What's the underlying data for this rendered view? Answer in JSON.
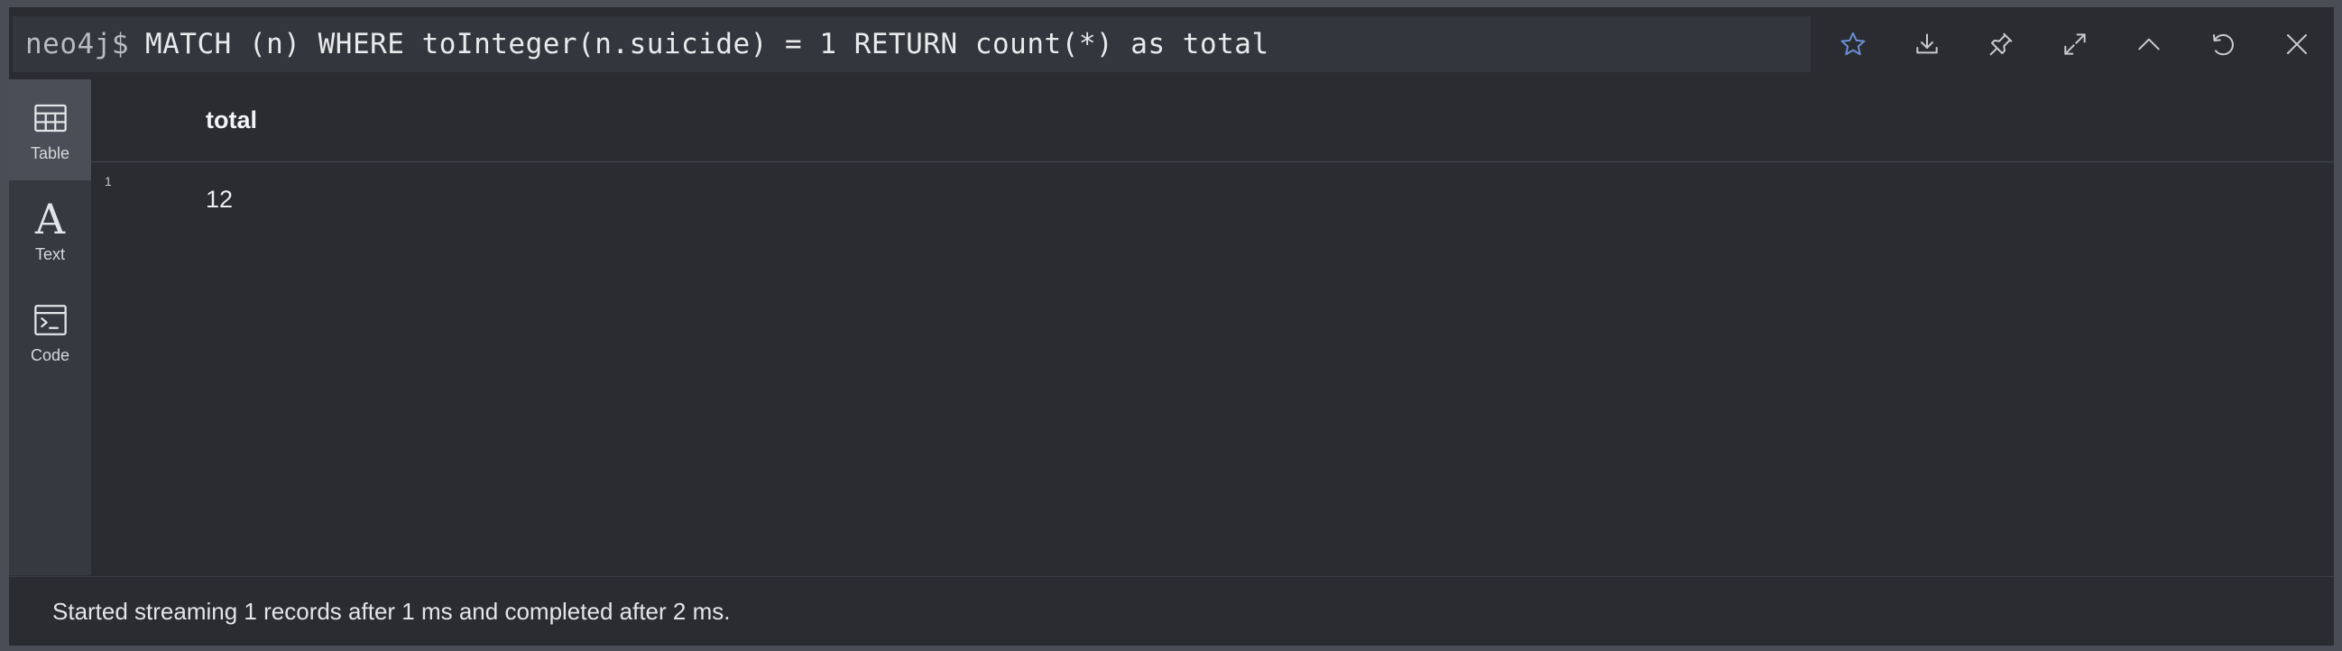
{
  "editor": {
    "prompt": "neo4j$",
    "query": "MATCH (n) WHERE toInteger(n.suicide) = 1 RETURN count(*) as total"
  },
  "toolbar": {
    "icons": [
      "star-icon",
      "download-icon",
      "pin-icon",
      "expand-icon",
      "collapse-icon",
      "rerun-icon",
      "close-icon"
    ],
    "star_color": "#6a8fd6"
  },
  "sidebar": {
    "items": [
      {
        "label": "Table",
        "icon": "table-icon",
        "active": true
      },
      {
        "label": "Text",
        "icon": "text-icon",
        "active": false
      },
      {
        "label": "Code",
        "icon": "code-icon",
        "active": false
      }
    ]
  },
  "table": {
    "columns": [
      "total"
    ],
    "rows": [
      {
        "index": "1",
        "cells": [
          "12"
        ]
      }
    ]
  },
  "status": {
    "message": "Started streaming 1 records after 1 ms and completed after 2 ms."
  }
}
